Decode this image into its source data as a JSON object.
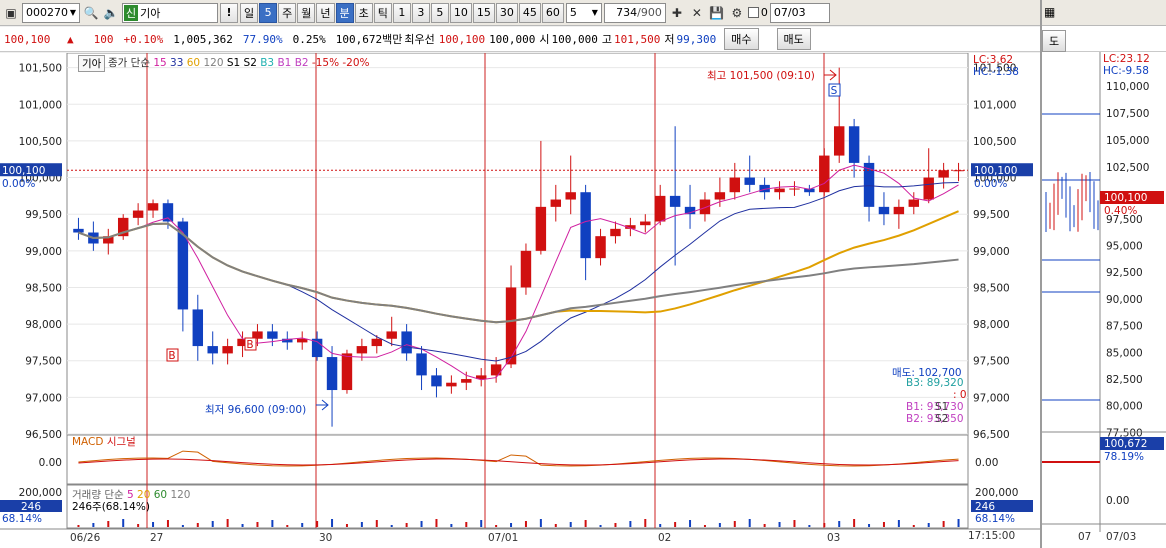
{
  "toolbar": {
    "code": "000270",
    "name_badge": "신",
    "name": "기아",
    "period_buttons": [
      "일",
      "5",
      "주",
      "월",
      "년",
      "분",
      "초",
      "틱",
      "1",
      "3",
      "5",
      "10",
      "15",
      "30",
      "45",
      "60"
    ],
    "active_period": "분",
    "count": "5",
    "page_count": "734",
    "page_total": "/900",
    "check_label": "0",
    "date": "07/03"
  },
  "quote": {
    "price": "100,100",
    "arrow": "▲",
    "change": "100",
    "pct": "+0.10%",
    "volume": "1,005,362",
    "vol_ratio": "77.90%",
    "turnover": "0.25%",
    "amount": "100,672백만",
    "best_label": "최우선",
    "best1": "100,100",
    "best2": "100,000",
    "open_label": "시",
    "open": "100,000",
    "high_label": "고",
    "high": "101,500",
    "low_label": "저",
    "low": "99,300",
    "buy_btn": "매수",
    "sell_btn": "매도"
  },
  "legend": {
    "name": "기아",
    "items": [
      "종가",
      "단순",
      "15",
      "33",
      "60",
      "120",
      "S1",
      "S2",
      "B3",
      "B1",
      "B2",
      "-15%",
      "-20%"
    ]
  },
  "price_axis": {
    "ticks": [
      "101,500",
      "101,000",
      "100,500",
      "100,000",
      "99,500",
      "99,000",
      "98,500",
      "98,000",
      "97,500",
      "97,000",
      "96,500"
    ],
    "current": "100,100",
    "current_pct": "0.00%",
    "lc": "LC:3.62",
    "hc": "HC:-1.38"
  },
  "annotations": {
    "high": "최고 101,500 (09:10)",
    "low": "최저 96,600 (09:00)",
    "sell_line": "매도: 102,700",
    "b3": "B3: 89,320",
    "zero": ": 0",
    "b1": "B1: 93,730",
    "b2": "B2: 93,350",
    "s1": "S1",
    "s2": "S2"
  },
  "macd": {
    "label": "MACD",
    "signal": "시그널",
    "tick": "0.00"
  },
  "volume_panel": {
    "label": "거래량",
    "ma": "단순",
    "ma_periods": [
      "5",
      "20",
      "60",
      "120"
    ],
    "info": "246주(68.14%)",
    "tick": "200,000",
    "current": "246",
    "pct": "68.14%"
  },
  "dates": [
    "06/26",
    "27",
    "30",
    "07/01",
    "02",
    "03"
  ],
  "clock": "17:15:00",
  "side": {
    "tab": "도",
    "lc": "LC:23.12",
    "hc": "HC:-9.58",
    "ticks": [
      "110,000",
      "107,500",
      "105,000",
      "102,500",
      "97,500",
      "95,000",
      "92,500",
      "90,000",
      "87,500",
      "85,000",
      "82,500",
      "80,000",
      "77,500"
    ],
    "current": "100,100",
    "pct": "0.40%",
    "vol_current": "100,672",
    "vol_pct": "78.19%",
    "macd_tick": "0.00",
    "dates": [
      "07",
      "07/03"
    ]
  },
  "colors": {
    "up": "#d01010",
    "down": "#1040c0",
    "ma5": "#d020a0",
    "ma20": "#e0a000",
    "ma60": "#808080",
    "ma15": "#2030a0"
  },
  "chart_data": {
    "type": "candlestick",
    "intraday_ohlc": [
      [
        99300,
        99450,
        99150,
        99250
      ],
      [
        99250,
        99400,
        99000,
        99100
      ],
      [
        99100,
        99300,
        98950,
        99200
      ],
      [
        99200,
        99500,
        99150,
        99450
      ],
      [
        99450,
        99650,
        99350,
        99550
      ],
      [
        99550,
        99700,
        99450,
        99650
      ],
      [
        99650,
        99700,
        99300,
        99400
      ],
      [
        99400,
        99450,
        97900,
        98200
      ],
      [
        98200,
        98400,
        97500,
        97700
      ],
      [
        97700,
        97900,
        97450,
        97600
      ],
      [
        97600,
        97800,
        97450,
        97700
      ],
      [
        97700,
        97900,
        97550,
        97800
      ],
      [
        97800,
        98000,
        97700,
        97900
      ],
      [
        97900,
        98000,
        97700,
        97800
      ],
      [
        97800,
        97900,
        97650,
        97750
      ],
      [
        97750,
        97900,
        97650,
        97800
      ],
      [
        97800,
        97900,
        97500,
        97550
      ],
      [
        97550,
        97700,
        96600,
        97100
      ],
      [
        97100,
        97650,
        97050,
        97600
      ],
      [
        97600,
        97800,
        97500,
        97700
      ],
      [
        97700,
        97850,
        97600,
        97800
      ],
      [
        97800,
        98100,
        97700,
        97900
      ],
      [
        97900,
        98000,
        97500,
        97600
      ],
      [
        97600,
        97700,
        97100,
        97300
      ],
      [
        97300,
        97400,
        97000,
        97150
      ],
      [
        97150,
        97300,
        97050,
        97200
      ],
      [
        97200,
        97350,
        97100,
        97250
      ],
      [
        97250,
        97400,
        97150,
        97300
      ],
      [
        97300,
        97550,
        97200,
        97450
      ],
      [
        97450,
        98800,
        97400,
        98500
      ],
      [
        98500,
        99100,
        98400,
        99000
      ],
      [
        99000,
        100500,
        98950,
        99600
      ],
      [
        99600,
        99900,
        99400,
        99700
      ],
      [
        99700,
        100300,
        99500,
        99800
      ],
      [
        99800,
        99900,
        98600,
        98900
      ],
      [
        98900,
        99300,
        98800,
        99200
      ],
      [
        99200,
        99400,
        99100,
        99300
      ],
      [
        99300,
        99450,
        99200,
        99350
      ],
      [
        99350,
        99500,
        99250,
        99400
      ],
      [
        99400,
        99900,
        99350,
        99750
      ],
      [
        99750,
        100700,
        98800,
        99600
      ],
      [
        99600,
        99900,
        99300,
        99500
      ],
      [
        99500,
        99800,
        99400,
        99700
      ],
      [
        99700,
        100000,
        99600,
        99800
      ],
      [
        99800,
        100200,
        99700,
        100000
      ],
      [
        100000,
        100300,
        99800,
        99900
      ],
      [
        99900,
        100000,
        99700,
        99800
      ],
      [
        99800,
        99950,
        99700,
        99850
      ],
      [
        99850,
        99950,
        99750,
        99850
      ],
      [
        99850,
        99900,
        99750,
        99800
      ],
      [
        99800,
        100400,
        99750,
        100300
      ],
      [
        100300,
        101500,
        100200,
        100700
      ],
      [
        100700,
        100800,
        100000,
        100200
      ],
      [
        100200,
        100300,
        99400,
        99600
      ],
      [
        99600,
        99800,
        99350,
        99500
      ],
      [
        99500,
        99700,
        99300,
        99600
      ],
      [
        99600,
        99800,
        99500,
        99700
      ],
      [
        99700,
        100400,
        99650,
        100000
      ],
      [
        100000,
        100200,
        99850,
        100100
      ],
      [
        100100,
        100200,
        99950,
        100100
      ]
    ],
    "ma_periods": [
      5,
      15,
      33,
      60
    ],
    "ylim": [
      96500,
      101700
    ],
    "x_labels": [
      "06/26",
      "27",
      "30",
      "07/01",
      "02",
      "03"
    ],
    "high_marker": "최고 101,500 (09:10)",
    "low_marker": "최저 96,600 (09:00)"
  }
}
